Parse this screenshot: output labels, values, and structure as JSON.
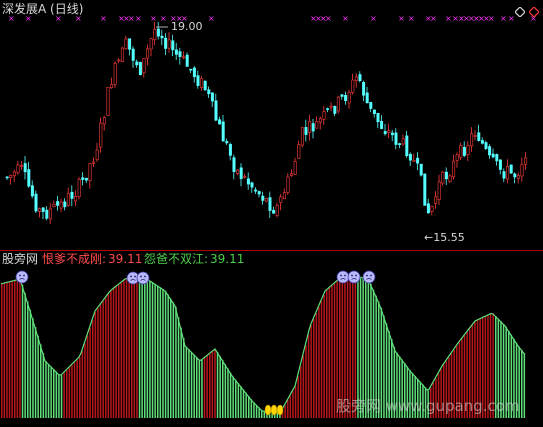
{
  "colors": {
    "background": "#000000",
    "up": "#ff3b3b",
    "down": "#54ffff",
    "ind_red": "#b8161b",
    "ind_green": "#5fe07a",
    "title": "#d8d8d8",
    "marker": "#ff33ff",
    "label_red": "#ff4b4b",
    "label_green": "#4bd04b"
  },
  "top_panel": {
    "title": "深发展A (日线)",
    "high_label": "19.00",
    "low_label": "←15.55",
    "corner_icon": "diamond-settings-icon"
  },
  "bottom_panel": {
    "name": "股旁网",
    "line1_label": "恨爹不成刚:",
    "line1_value": "39.11",
    "line2_label": "怨爸不双江:",
    "line2_value": "39.11"
  },
  "watermark": {
    "text": "股旁网 www.gupang.com"
  },
  "chart_data": {
    "type": "candlestick+indicator",
    "price_high": 19.0,
    "price_low": 15.55,
    "indicator_value": 39.11
  }
}
